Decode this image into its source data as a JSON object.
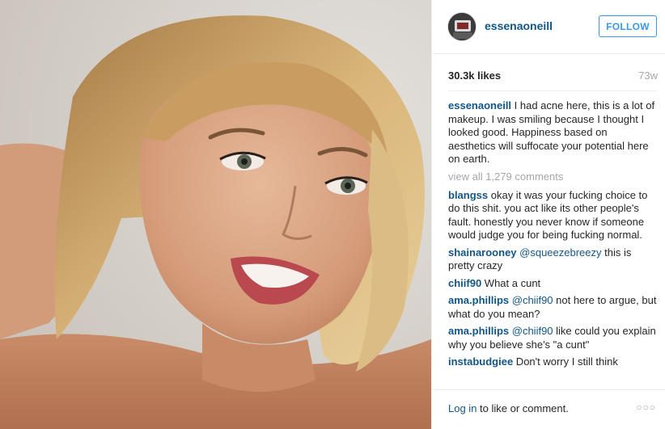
{
  "post": {
    "photo_icon": "selfie-photo",
    "owner": "essenaoneill",
    "follow_label": "FOLLOW",
    "likes": "30.3k likes",
    "age": "73w"
  },
  "caption": {
    "user": "essenaoneill",
    "text": " I had acne here, this is a lot of makeup. I was smiling because I thought I looked good. Happiness based on aesthetics will suffocate your potential here on earth."
  },
  "view_all": "view all 1,279 comments",
  "comments": [
    {
      "user": "blangss",
      "mention": "",
      "text": " okay it was your fucking choice to do this shit. you act like its other people's fault. honestly you never know if someone would judge you for being fucking normal."
    },
    {
      "user": "shainarooney",
      "mention": " @squeezebreezy",
      "text": " this is pretty crazy"
    },
    {
      "user": "chiif90",
      "mention": "",
      "text": " What a cunt"
    },
    {
      "user": "ama.phillips",
      "mention": " @chiif90",
      "text": " not here to argue, but what do you mean?"
    },
    {
      "user": "ama.phillips",
      "mention": " @chiif90",
      "text": " like could you explain why you believe she's \"a cunt\""
    },
    {
      "user": "instabudgiee",
      "mention": "",
      "text": " Don't worry I still think"
    }
  ],
  "footer": {
    "login_link": "Log in",
    "login_rest": " to like or comment.",
    "more_icon": "more-options-icon"
  },
  "colors": {
    "link": "#125688",
    "follow": "#3897f0",
    "muted": "#a5a7aa"
  }
}
